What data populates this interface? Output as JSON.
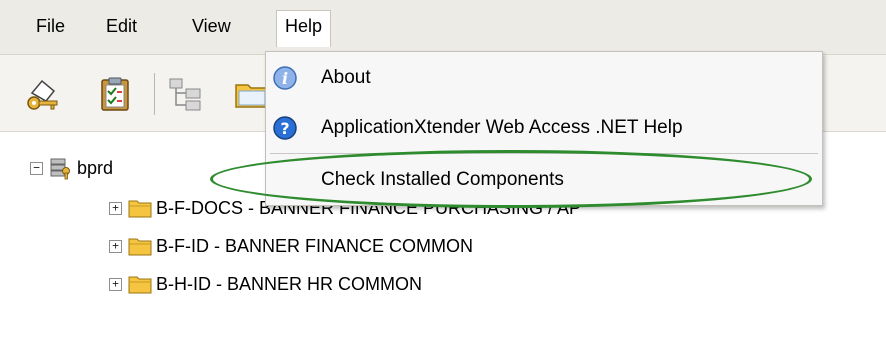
{
  "menubar": {
    "items": [
      "File",
      "Edit",
      "View",
      "Help"
    ]
  },
  "toolbar": {
    "icons": [
      "key-login-icon",
      "clipboard-checklist-icon",
      "tree-structure-icon",
      "folder-open-icon"
    ]
  },
  "tree": {
    "root": {
      "label": "bprd",
      "expander": "−"
    },
    "children": [
      {
        "label": "B-F-DOCS - BANNER FINANCE PURCHASING / AP",
        "expander": "+"
      },
      {
        "label": "B-F-ID - BANNER FINANCE COMMON",
        "expander": "+"
      },
      {
        "label": "B-H-ID - BANNER HR COMMON",
        "expander": "+"
      }
    ]
  },
  "help_menu": {
    "items": [
      {
        "label": "About",
        "icon": "info-icon"
      },
      {
        "label": "ApplicationXtender Web Access .NET Help",
        "icon": "help-question-icon"
      },
      {
        "label": "Check Installed Components",
        "icon": ""
      }
    ]
  },
  "colors": {
    "highlight_ellipse": "#2e8b2e",
    "menubar_bg": "#ecebe6",
    "folder_yellow": "#f5c542"
  }
}
